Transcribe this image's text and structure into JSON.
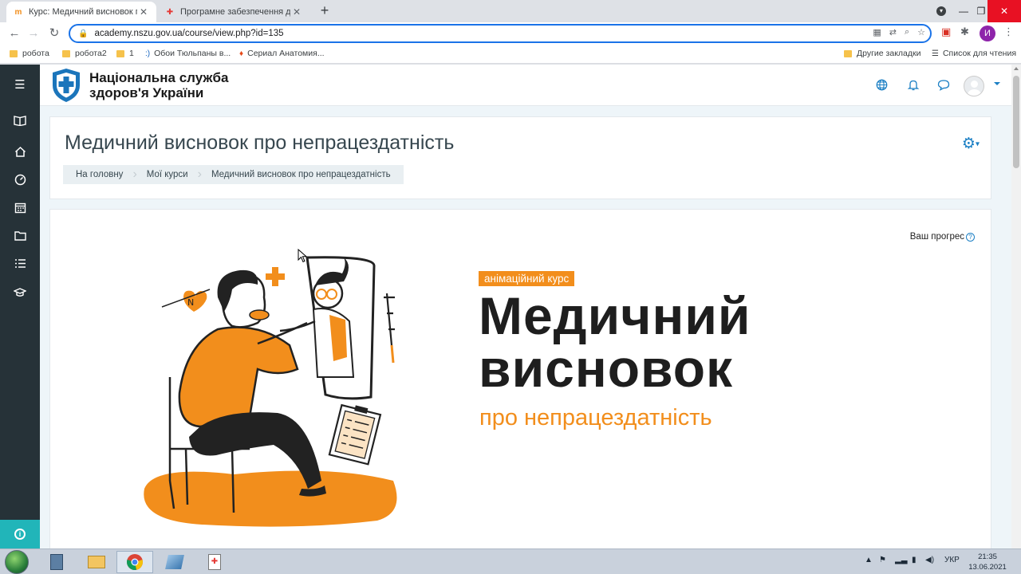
{
  "browser": {
    "tabs": [
      {
        "title": "Курс: Медичний висновок про",
        "active": true
      },
      {
        "title": "Програмне забезпечення для",
        "active": false
      }
    ],
    "new_tab_label": "+",
    "url": "academy.nszu.gov.ua/course/view.php?id=135",
    "profile_initial": "И",
    "bookmarks": [
      {
        "label": "робота"
      },
      {
        "label": "робота2"
      },
      {
        "label": "1"
      },
      {
        "label": "Обои Тюльпаны в..."
      },
      {
        "label": "Сериал Анатомия..."
      }
    ],
    "bookmarks_right": {
      "other": "Другие закладки",
      "reading_list": "Список для чтения"
    }
  },
  "site": {
    "logo_line1": "Національна служба",
    "logo_line2": "здоров'я України"
  },
  "course": {
    "title": "Медичний висновок про непрацездатність",
    "breadcrumb": [
      "На головну",
      "Мої курси",
      "Медичний висновок про непрацездатність"
    ],
    "progress_label": "Ваш прогрес",
    "progress_help": "?"
  },
  "banner": {
    "tag": "анімаційний курс",
    "heading_line1": "Медичний",
    "heading_line2": "висновок",
    "subheading": "про непрацездатність"
  },
  "taskbar": {
    "language": "УКР",
    "time": "21:35",
    "date": "13.06.2021"
  },
  "colors": {
    "accent": "#1b7fc4",
    "orange": "#f28e1c",
    "sidebar": "#263238",
    "teal": "#21b5b9"
  }
}
